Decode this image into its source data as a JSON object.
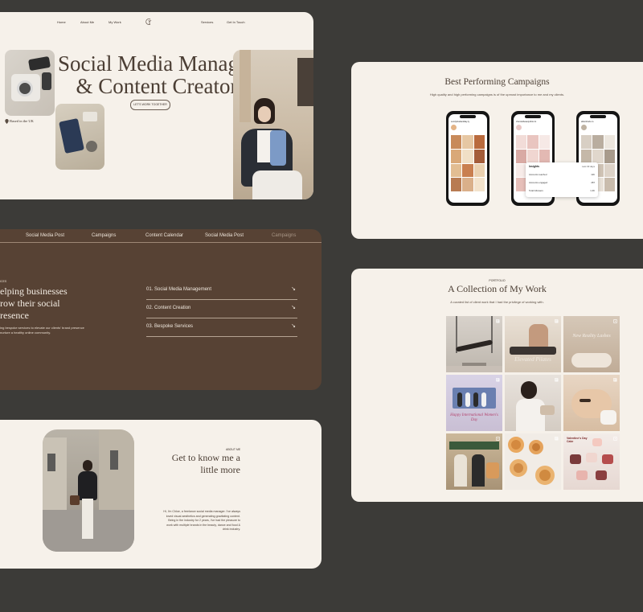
{
  "hero": {
    "nav": [
      "Home",
      "About Me",
      "My Work",
      "Services",
      "Get In Touch"
    ],
    "title_line1": "Social Media Manager",
    "title_line2": "& Content Creator",
    "location": "Based in the UK",
    "cta": "LET'S WORK TOGETHER"
  },
  "campaigns": {
    "title": "Best Performing Campaigns",
    "subtitle": "High quality and high performing campaigns is of the upmost importance to me and my clients.",
    "phone_handles": [
      "sundyfoodandday.ty",
      "chemistbeautyclinic.lo",
      "aftershock.co"
    ],
    "insights": {
      "title": "Insights",
      "period": "Last 30 days",
      "rows": [
        {
          "label": "Accounts reached",
          "value": "11K"
        },
        {
          "label": "Accounts engaged",
          "value": "287"
        },
        {
          "label": "Total followers",
          "value": "1.4K"
        }
      ]
    }
  },
  "services": {
    "marquee": [
      "Social Media Post",
      "Campaigns",
      "Content Calendar",
      "Social Media Post",
      "Campaigns"
    ],
    "kicker": "ICES",
    "heading_lines": [
      "elping businesses",
      "row their social",
      "resence"
    ],
    "desc_lines": [
      "ing bespoke services to elevate our clients' brand presence",
      "nurture a healthy online community."
    ],
    "items": [
      "01. Social Media Management",
      "02. Content Creation",
      "03. Bespoke Services"
    ],
    "arrow": "↘"
  },
  "about": {
    "kicker": "ABOUT ME",
    "heading_line1": "Get to know me a",
    "heading_line2": "little more",
    "bio_lines": [
      "Hi, I'm Chloe, a freelance social media manager. I've always",
      "loved visual aesthetics and generating gravitating content.",
      "Being in the industry for 2 years, I've had the pleasure to",
      "work with multiple brands in the beauty, dance and food &",
      "drink industry."
    ]
  },
  "portfolio": {
    "kicker": "PORTFOLIO",
    "title": "A Collection of My Work",
    "subtitle": "A curated list of client work that I had the privilege of working with.",
    "tile_captions": [
      "",
      "Elevated Pilates",
      "New Reality Lashes",
      "Happy International Women's Day",
      "",
      "",
      "",
      "",
      "Valentine's Day Cake"
    ]
  },
  "colors": {
    "page_bg": "#3c3b38",
    "card_bg": "#f6f1ea",
    "services_bg": "#574234",
    "heading_brown": "#4b3e34"
  }
}
